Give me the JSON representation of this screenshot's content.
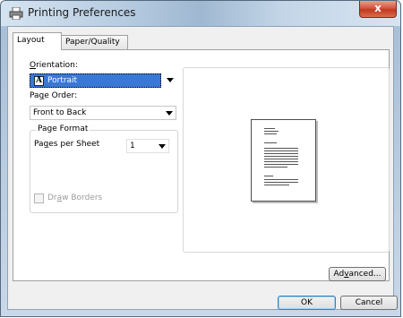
{
  "window": {
    "title": "Printing Preferences",
    "close_glyph": "x",
    "printer_icon": "printer-icon",
    "close_icon": "close-icon"
  },
  "tabs": [
    {
      "label": "Layout",
      "active": true
    },
    {
      "label": "Paper/Quality",
      "active": false
    }
  ],
  "layout": {
    "orientation": {
      "label_first": "O",
      "label_rest": "rientation:",
      "value": "Portrait",
      "icon_letter": "A"
    },
    "page_order": {
      "label_first": "Pa",
      "label_u": "g",
      "label_rest": "e Order:",
      "value": "Front to Back"
    },
    "page_format": {
      "title": "Page Format",
      "pages_per_sheet": {
        "label_first": "Pa",
        "label_u": "g",
        "label_rest": "es per Sheet",
        "value": "1"
      },
      "draw_borders": {
        "label_first": "Dr",
        "label_u": "a",
        "label_rest": "w Borders",
        "checked": false,
        "enabled": false
      }
    }
  },
  "buttons": {
    "advanced": {
      "first": "Ad",
      "u": "v",
      "rest": "anced..."
    },
    "ok": "OK",
    "cancel": "Cancel"
  },
  "colors": {
    "selection": "#3a78d6",
    "close": "#c2391e"
  }
}
